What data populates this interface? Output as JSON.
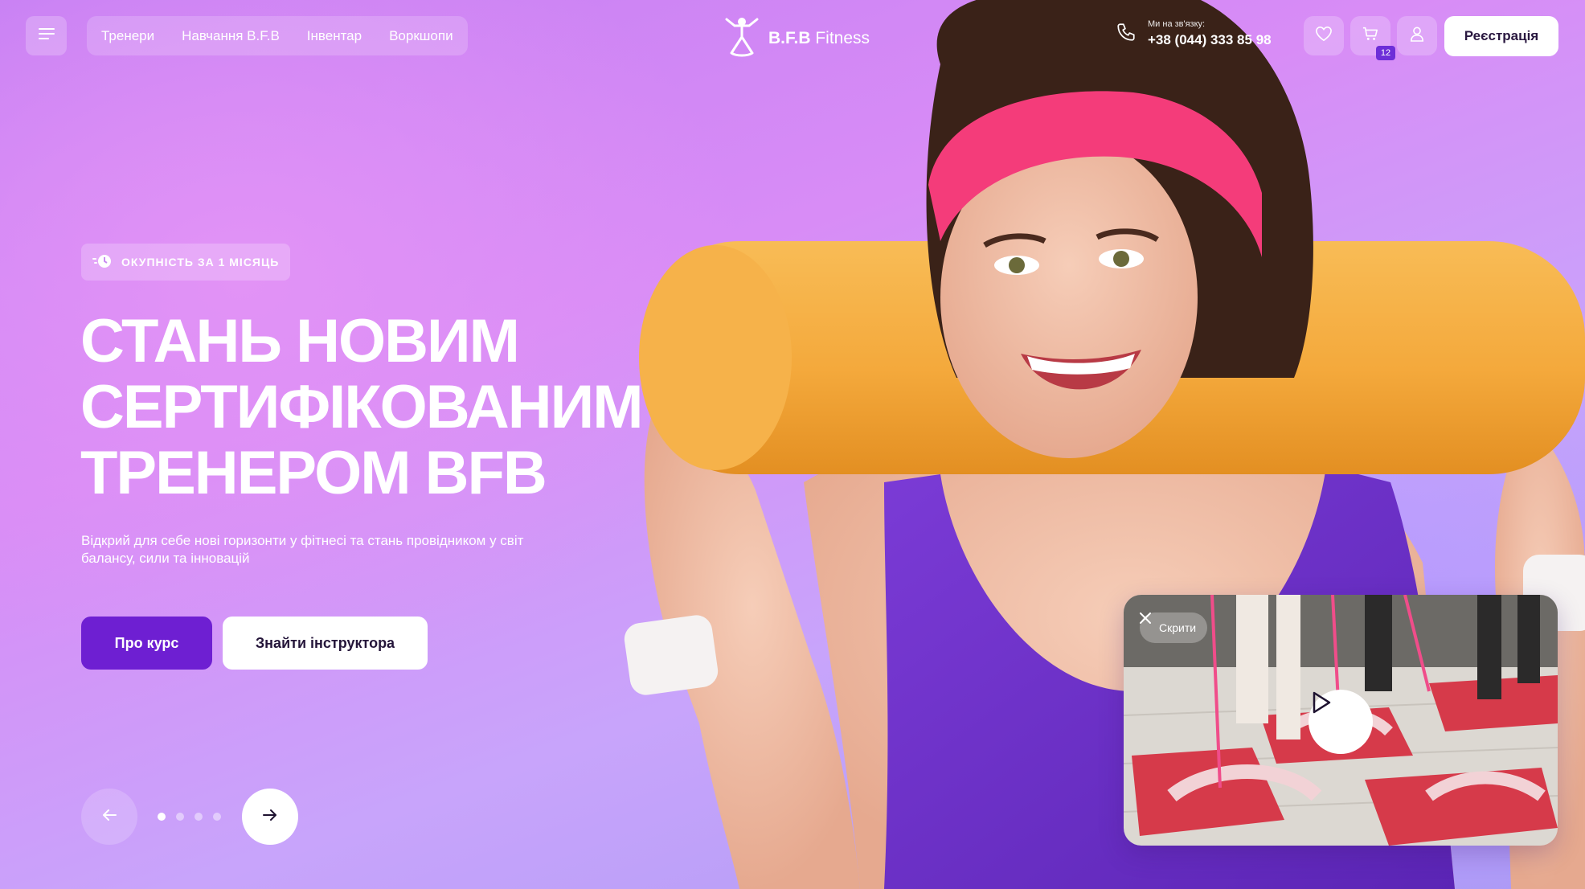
{
  "header": {
    "nav": [
      "Тренери",
      "Навчання B.F.B",
      "Інвентар",
      "Воркшопи"
    ],
    "logo": {
      "bold": "B.F.B",
      "light": " Fitness"
    },
    "contact": {
      "label": "Ми на зв'язку:",
      "phone": "+38 (044) 333 85 98"
    },
    "cart_count": "12",
    "register_label": "Реєстрація"
  },
  "hero": {
    "tag": "ОКУПНІСТЬ ЗА 1 МІСЯЦЬ",
    "headline": [
      "СТАНЬ НОВИМ",
      "СЕРТИФІКОВАНИМ",
      "ТРЕНЕРОМ BFB"
    ],
    "description": "Відкрий для себе нові горизонти у фітнесі та стань провідником у світ балансу, сили та інновацій",
    "primary_button": "Про курс",
    "secondary_button": "Знайти інструктора"
  },
  "slider": {
    "dots": 4,
    "active": 0
  },
  "video": {
    "hide_label": "Скрити"
  },
  "colors": {
    "accent": "#6e1fd2",
    "mat": "#f4a93c",
    "headband": "#f43c7a",
    "top": "#6b2fc8"
  },
  "icons": [
    "menu-icon",
    "bfb-logo-icon",
    "phone-icon",
    "heart-icon",
    "cart-icon",
    "user-icon",
    "clock-speed-icon",
    "arrow-left-icon",
    "arrow-right-icon",
    "close-icon",
    "play-icon"
  ]
}
